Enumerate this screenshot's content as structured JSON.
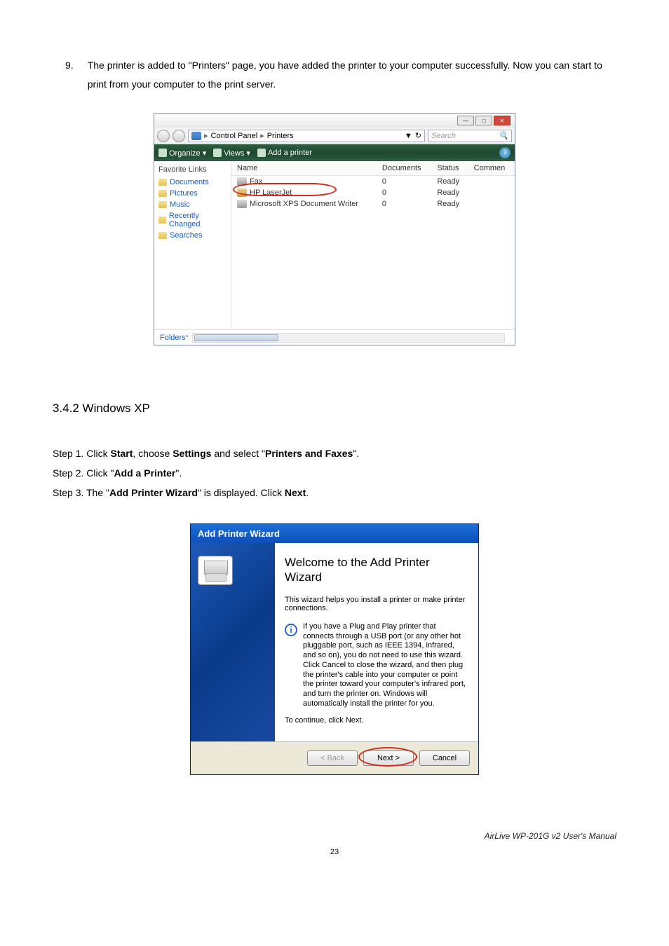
{
  "main": {
    "step9_num": "9.",
    "step9_text": "The printer is added to \"Printers\" page, you have added the printer to your computer successfully. Now you can start to print from your computer to the print server."
  },
  "vista": {
    "breadcrumb1": "Control Panel",
    "breadcrumb2": "Printers",
    "search_placeholder": "Search",
    "refresh_dd": "▼",
    "toolbar_organize": "Organize ▾",
    "toolbar_views": "Views ▾",
    "toolbar_add": "Add a printer",
    "help": "?",
    "sidebar_title": "Favorite Links",
    "sidebar_links": [
      "Documents",
      "Pictures",
      "Music",
      "Recently Changed",
      "Searches"
    ],
    "columns": [
      "Name",
      "Documents",
      "Status",
      "Commen"
    ],
    "rows": [
      {
        "name": "Fax",
        "docs": "0",
        "status": "Ready"
      },
      {
        "name": "HP LaserJet",
        "docs": "0",
        "status": "Ready"
      },
      {
        "name": "Microsoft XPS Document Writer",
        "docs": "0",
        "status": "Ready"
      }
    ],
    "folders_label": "Folders",
    "folders_chevron": "^"
  },
  "section": {
    "heading": "3.4.2 Windows XP",
    "step1_prefix": "Step 1. Click ",
    "step1_b1": "Start",
    "step1_mid1": ", choose ",
    "step1_b2": "Settings",
    "step1_mid2": " and select \"",
    "step1_b3": "Printers and Faxes",
    "step1_end": "\".",
    "step2_prefix": "Step 2. Click \"",
    "step2_b1": "Add a Printer",
    "step2_end": "\".",
    "step3_prefix": "Step 3. The \"",
    "step3_b1": "Add Printer Wizard",
    "step3_mid": "\" is displayed. Click ",
    "step3_b2": "Next",
    "step3_end": "."
  },
  "wizard": {
    "title": "Add Printer Wizard",
    "heading": "Welcome to the Add Printer Wizard",
    "p1": "This wizard helps you install a printer or make printer connections.",
    "info": "If you have a Plug and Play printer that connects through a USB port (or any other hot pluggable port, such as IEEE 1394, infrared, and so on), you do not need to use this wizard. Click Cancel to close the wizard, and then plug the printer's cable into your computer or point the printer toward your computer's infrared port, and turn the printer on. Windows will automatically install the printer for you.",
    "continue": "To continue, click Next.",
    "btn_back": "< Back",
    "btn_next": "Next >",
    "btn_cancel": "Cancel"
  },
  "footer": {
    "manual": "AirLive WP-201G v2 User's Manual",
    "page": "23"
  }
}
